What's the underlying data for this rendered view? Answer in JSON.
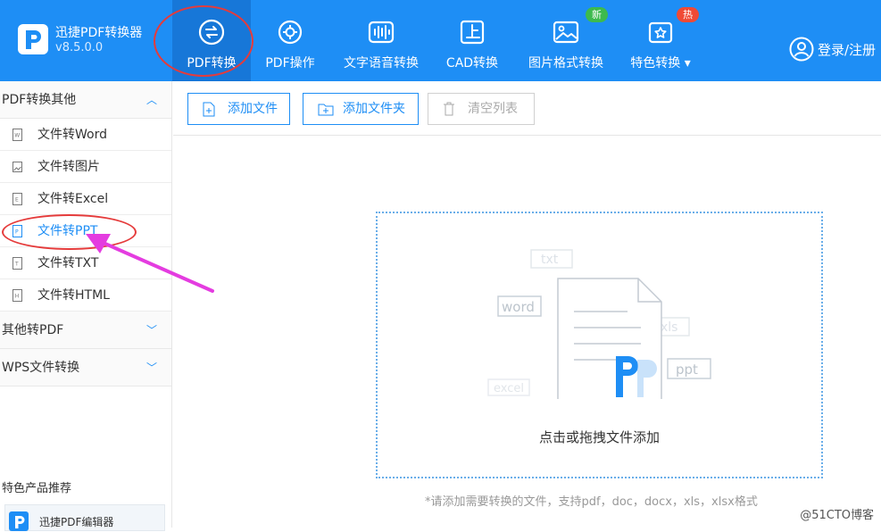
{
  "app": {
    "name": "迅捷PDF转换器",
    "version": "v8.5.0.0"
  },
  "nav": [
    {
      "label": "PDF转换",
      "icon": "convert-icon",
      "active": true
    },
    {
      "label": "PDF操作",
      "icon": "gear-icon"
    },
    {
      "label": "文字语音转换",
      "icon": "sound-wave-icon"
    },
    {
      "label": "CAD转换",
      "icon": "cad-icon"
    },
    {
      "label": "图片格式转换",
      "icon": "image-icon",
      "badge": "新"
    },
    {
      "label": "特色转换",
      "icon": "star-convert-icon",
      "badge": "热"
    }
  ],
  "login_label": "登录/注册",
  "sidebar": {
    "group1": "PDF转换其他",
    "items": [
      {
        "label": "文件转Word",
        "icon_letter": "W"
      },
      {
        "label": "文件转图片",
        "icon_letter": "img"
      },
      {
        "label": "文件转Excel",
        "icon_letter": "E"
      },
      {
        "label": "文件转PPT",
        "icon_letter": "P",
        "active": true
      },
      {
        "label": "文件转TXT",
        "icon_letter": "T"
      },
      {
        "label": "文件转HTML",
        "icon_letter": "H"
      }
    ],
    "group2": "其他转PDF",
    "group3": "WPS文件转换",
    "recommend_title": "特色产品推荐",
    "recommend_item": "迅捷PDF编辑器"
  },
  "toolbar": {
    "add_file": "添加文件",
    "add_folder": "添加文件夹",
    "clear_list": "清空列表"
  },
  "dropzone": {
    "text": "点击或拖拽文件添加",
    "tags": [
      "txt",
      "word",
      "xls",
      "ppt",
      "excel",
      "html"
    ]
  },
  "hint": "*请添加需要转换的文件，支持pdf，doc，docx，xls，xlsx格式",
  "watermark": "@51CTO博客",
  "colors": {
    "primary": "#1e8ef5",
    "annotation_red": "#e53b3b",
    "annotation_arrow": "#e43ce0"
  }
}
